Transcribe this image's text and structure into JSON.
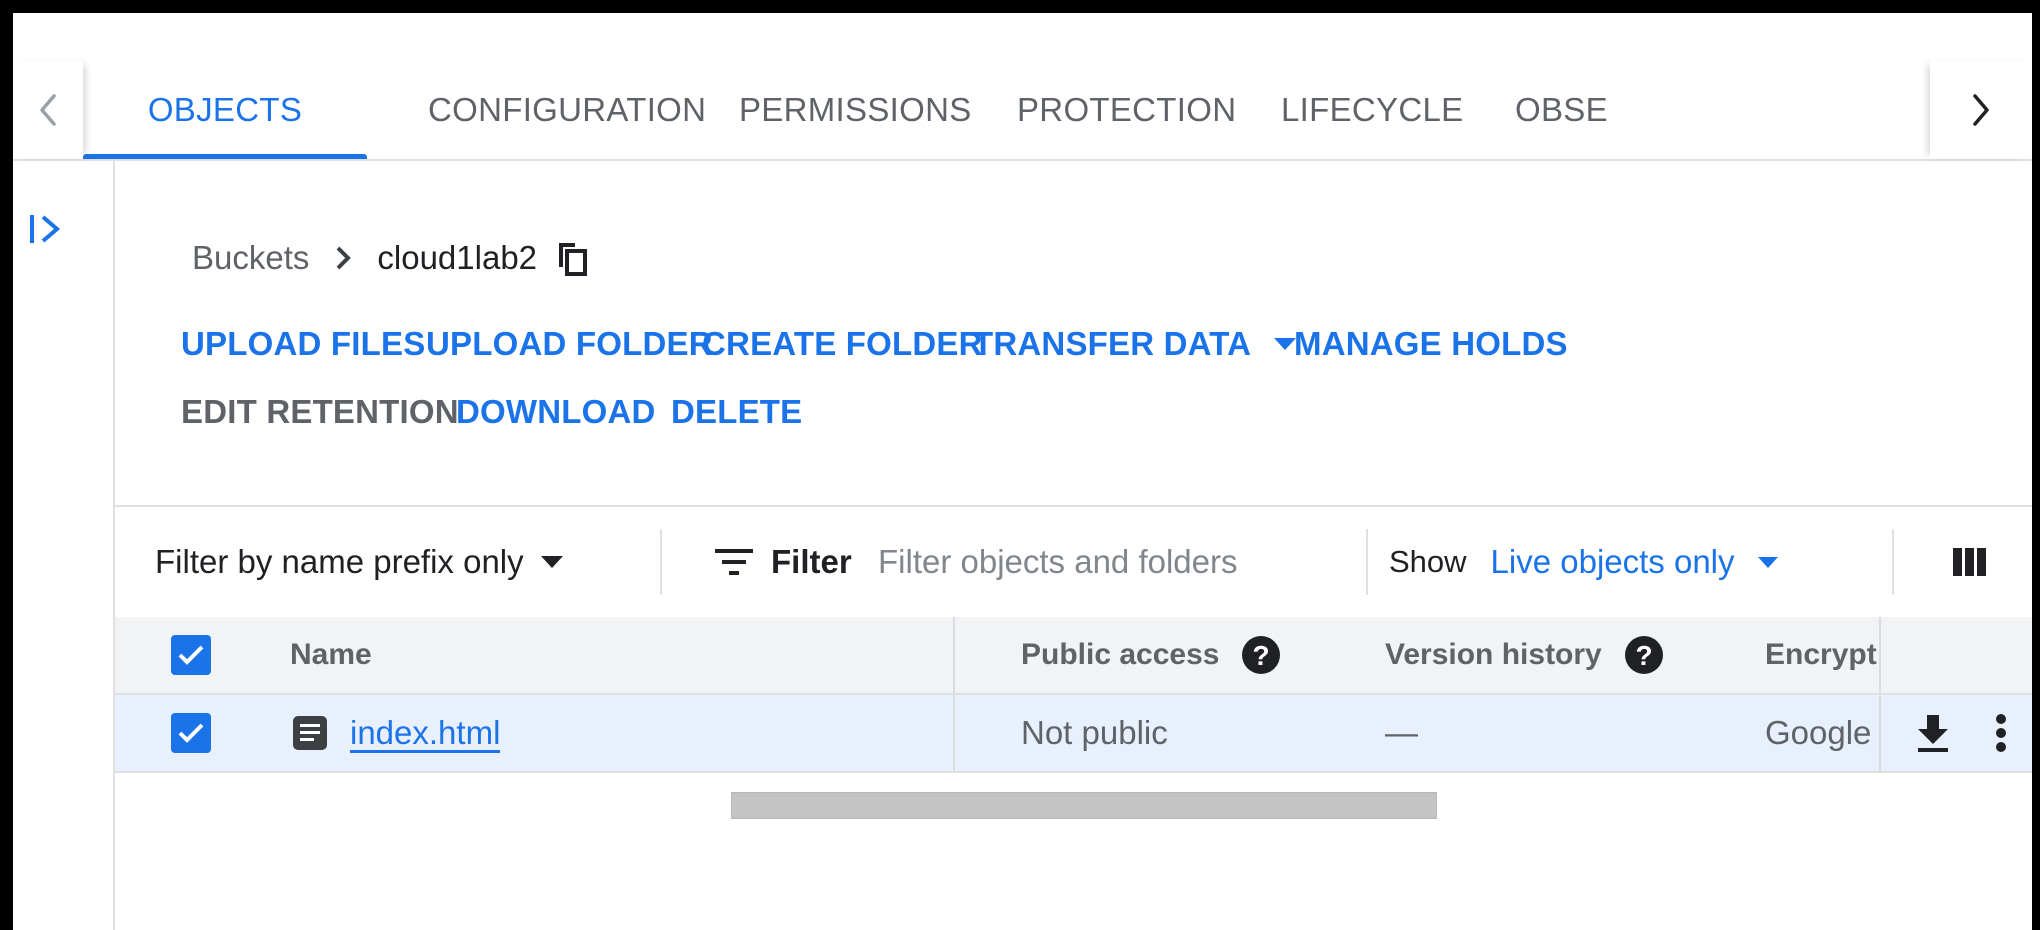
{
  "tabs": [
    {
      "label": "OBJECTS",
      "active": true
    },
    {
      "label": "CONFIGURATION",
      "active": false
    },
    {
      "label": "PERMISSIONS",
      "active": false
    },
    {
      "label": "PROTECTION",
      "active": false
    },
    {
      "label": "LIFECYCLE",
      "active": false
    },
    {
      "label": "OBSE",
      "active": false
    }
  ],
  "breadcrumb": {
    "parent": "Buckets",
    "current": "cloud1lab2"
  },
  "actions": {
    "upload_files": "UPLOAD FILES",
    "upload_folder": "UPLOAD FOLDER",
    "create_folder": "CREATE FOLDER",
    "transfer_data": "TRANSFER DATA",
    "manage_holds": "MANAGE HOLDS",
    "edit_retention": "EDIT RETENTION",
    "download": "DOWNLOAD",
    "delete": "DELETE"
  },
  "filterbar": {
    "prefix_mode": "Filter by name prefix only",
    "filter_label": "Filter",
    "filter_placeholder": "Filter objects and folders",
    "show_label": "Show",
    "show_value": "Live objects only"
  },
  "table": {
    "columns": {
      "name": "Name",
      "public_access": "Public access",
      "version_history": "Version history",
      "encryption": "Encrypt"
    },
    "rows": [
      {
        "name": "index.html",
        "public_access": "Not public",
        "version_history": "—",
        "encryption": "Google",
        "selected": true
      }
    ]
  },
  "colors": {
    "accent": "#1a73e8",
    "text_secondary": "#5f6368",
    "selected_row": "#e8f0fe"
  }
}
